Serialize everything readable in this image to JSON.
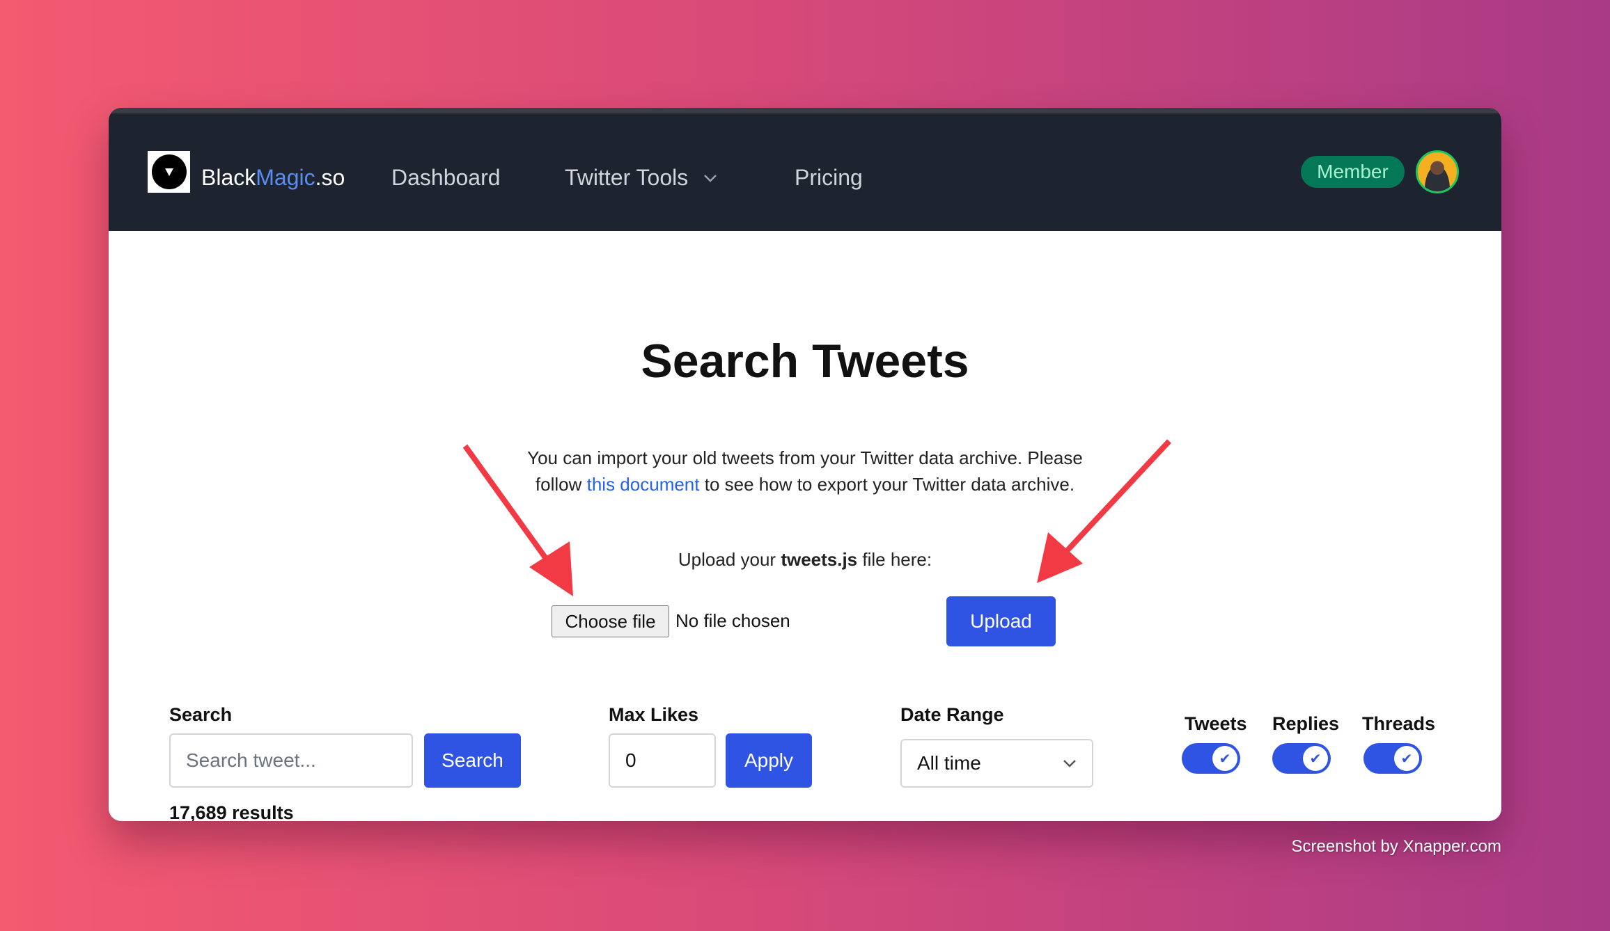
{
  "nav": {
    "brand_prefix": "Black",
    "brand_accent": "Magic",
    "brand_suffix": ".so",
    "items": [
      "Dashboard",
      "Twitter Tools",
      "Pricing"
    ],
    "badge": "Member"
  },
  "main": {
    "title": "Search Tweets",
    "intro_before": "You can import your old tweets from your Twitter data archive. Please follow ",
    "intro_link": "this document",
    "intro_after": " to see how to export your Twitter data archive.",
    "upload_before": "Upload your ",
    "upload_file": "tweets.js",
    "upload_after": " file here:",
    "choose_file": "Choose file",
    "no_file": "No file chosen",
    "upload_button": "Upload"
  },
  "filters": {
    "search_label": "Search",
    "search_placeholder": "Search tweet...",
    "search_button": "Search",
    "max_likes_label": "Max Likes",
    "max_likes_value": "0",
    "apply_button": "Apply",
    "date_range_label": "Date Range",
    "date_range_value": "All time",
    "toggles": [
      {
        "label": "Tweets",
        "on": true
      },
      {
        "label": "Replies",
        "on": true
      },
      {
        "label": "Threads",
        "on": true
      }
    ],
    "results": "17,689 results"
  },
  "colors": {
    "accent": "#2f54e3",
    "nav_bg": "#1e2330",
    "badge_bg": "#047857",
    "annotation_arrow": "#f23a45"
  },
  "watermark": "Screenshot by Xnapper.com"
}
